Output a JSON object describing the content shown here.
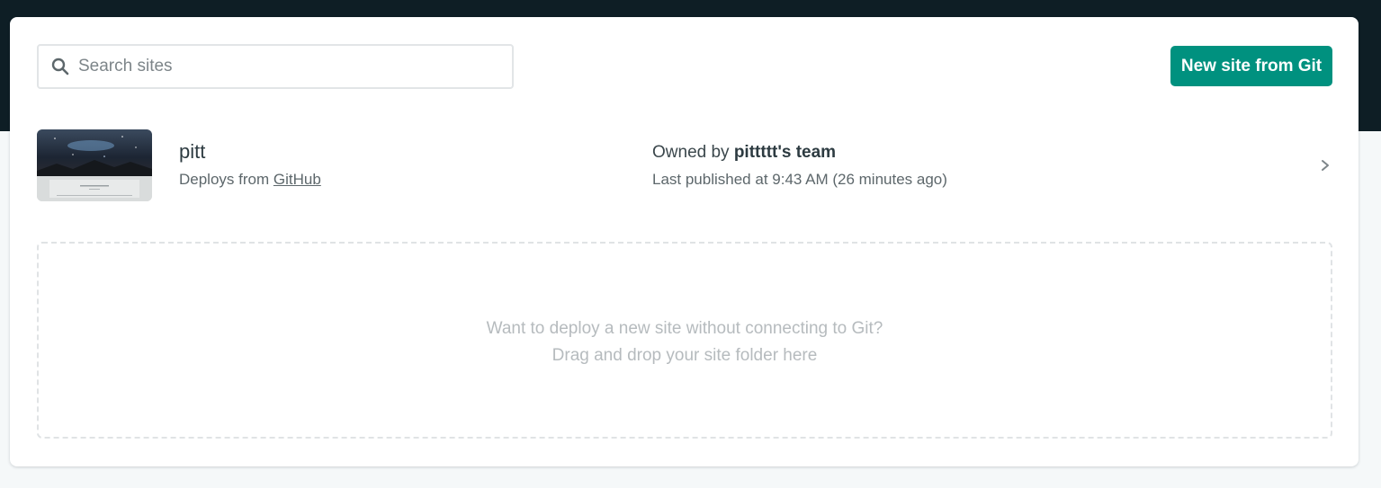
{
  "search": {
    "placeholder": "Search sites",
    "value": "",
    "icon": "search-icon"
  },
  "toolbar": {
    "new_site_label": "New site from Git"
  },
  "sites": [
    {
      "name": "pitt",
      "deploy_prefix": "Deploys from ",
      "deploy_source": "GitHub",
      "owner_prefix": "Owned by ",
      "owner_team": "pittttt's team",
      "published": "Last published at 9:43 AM (26 minutes ago)",
      "chevron_icon": "chevron-right-icon"
    }
  ],
  "dropzone": {
    "line1": "Want to deploy a new site without connecting to Git?",
    "line2": "Drag and drop your site folder here"
  },
  "colors": {
    "header_bg": "#0e1e25",
    "accent": "#00917f",
    "page_bg": "#f5f8f9"
  }
}
